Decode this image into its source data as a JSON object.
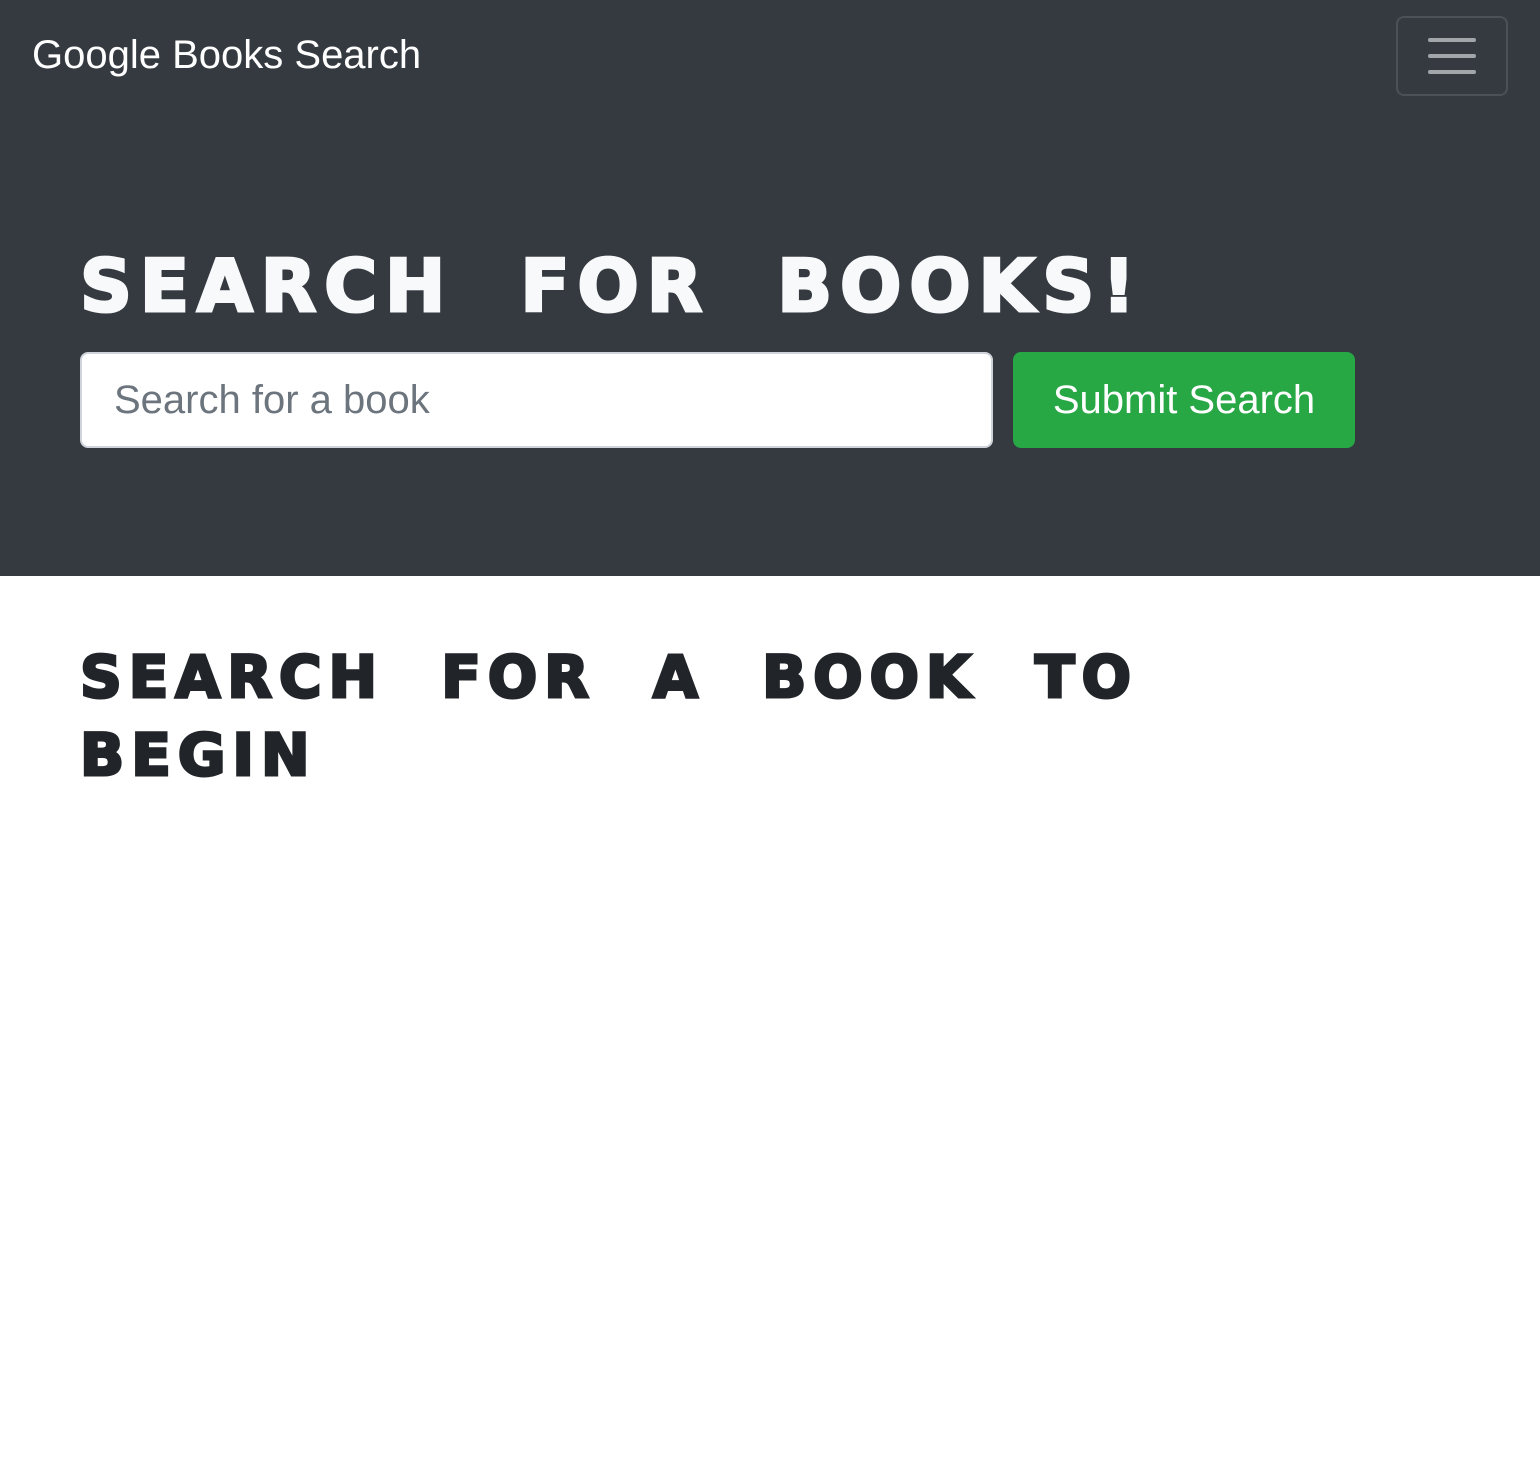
{
  "navbar": {
    "brand": "Google Books Search",
    "toggler_icon": "hamburger-menu-icon"
  },
  "hero": {
    "title": "SEARCH FOR BOOKS!",
    "search": {
      "placeholder": "Search for a book",
      "value": ""
    },
    "submit_label": "Submit Search"
  },
  "results": {
    "empty_message": "SEARCH FOR A BOOK TO BEGIN"
  },
  "colors": {
    "dark_bg": "#343a40",
    "success": "#28a745",
    "text_light": "#f8f9fa",
    "text_dark": "#212529"
  }
}
